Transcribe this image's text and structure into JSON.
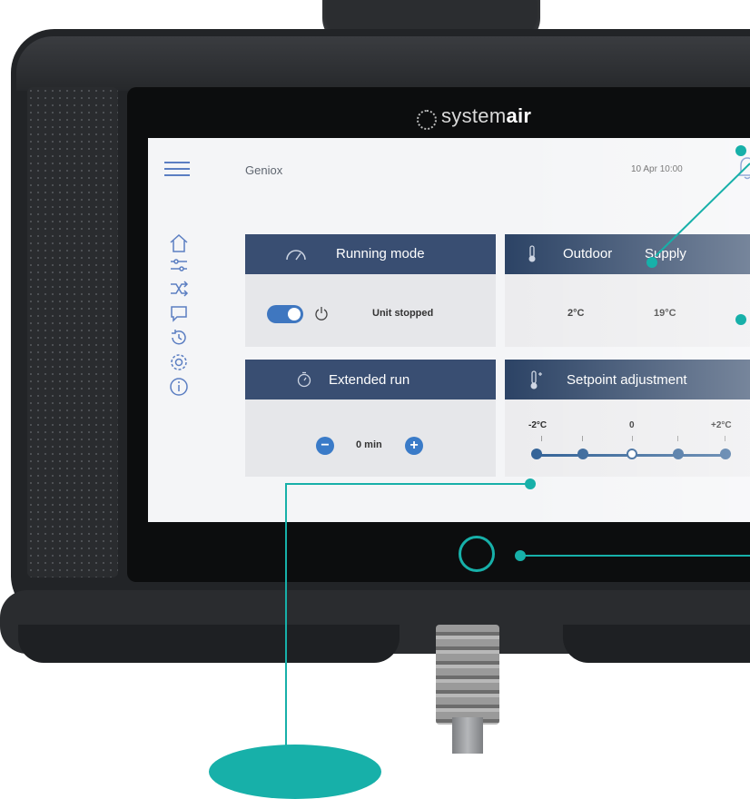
{
  "brand": {
    "prefix": "system",
    "suffix": "air"
  },
  "header": {
    "app_title": "Geniox",
    "datetime": "10 Apr 10:00"
  },
  "sidebar": {
    "items": [
      {
        "icon": "home-icon"
      },
      {
        "icon": "sliders-icon"
      },
      {
        "icon": "shuffle-icon"
      },
      {
        "icon": "chat-icon"
      },
      {
        "icon": "history-icon"
      },
      {
        "icon": "gear-icon"
      },
      {
        "icon": "info-icon"
      }
    ]
  },
  "cards": {
    "running_mode": {
      "title": "Running mode",
      "status": "Unit stopped"
    },
    "temperatures": {
      "outdoor_label": "Outdoor",
      "supply_label": "Supply",
      "outdoor_value": "2°C",
      "supply_value": "19°C"
    },
    "extended_run": {
      "title": "Extended run",
      "value": "0 min",
      "minus": "−",
      "plus": "+"
    },
    "setpoint": {
      "title": "Setpoint adjustment",
      "min_label": "-2°C",
      "mid_label": "0",
      "max_label": "+2°C",
      "level": 0
    }
  },
  "colors": {
    "header": "#394e72",
    "accent": "#3a7bc8",
    "callout": "#17b0a9"
  }
}
